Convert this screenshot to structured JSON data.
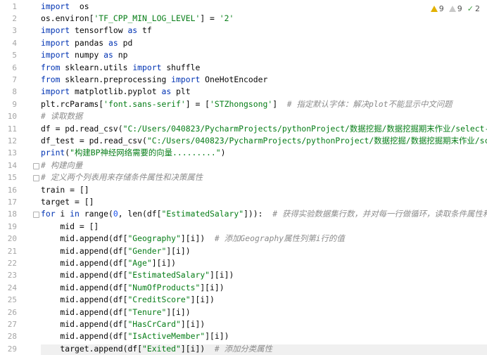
{
  "inspections": {
    "warnings": "9",
    "weak_warnings": "9",
    "typos": "2"
  },
  "lines": [
    {
      "n": "1",
      "tokens": [
        [
          "kw",
          "import"
        ],
        [
          "",
          "  os"
        ]
      ]
    },
    {
      "n": "2",
      "tokens": [
        [
          "",
          "os.environ["
        ],
        [
          "str",
          "'TF_CPP_MIN_LOG_LEVEL'"
        ],
        [
          "",
          "] = "
        ],
        [
          "str",
          "'2'"
        ]
      ]
    },
    {
      "n": "3",
      "tokens": [
        [
          "kw",
          "import"
        ],
        [
          "",
          " tensorflow "
        ],
        [
          "kw",
          "as"
        ],
        [
          "",
          " tf"
        ]
      ]
    },
    {
      "n": "4",
      "tokens": [
        [
          "kw",
          "import"
        ],
        [
          "",
          " pandas "
        ],
        [
          "kw",
          "as"
        ],
        [
          "",
          " pd"
        ]
      ]
    },
    {
      "n": "5",
      "tokens": [
        [
          "kw",
          "import"
        ],
        [
          "",
          " numpy "
        ],
        [
          "kw",
          "as"
        ],
        [
          "",
          " np"
        ]
      ]
    },
    {
      "n": "6",
      "tokens": [
        [
          "kw",
          "from"
        ],
        [
          "",
          " sklearn.utils "
        ],
        [
          "kw",
          "import"
        ],
        [
          "",
          " shuffle"
        ]
      ]
    },
    {
      "n": "7",
      "tokens": [
        [
          "kw",
          "from"
        ],
        [
          "",
          " sklearn.preprocessing "
        ],
        [
          "kw",
          "import"
        ],
        [
          "",
          " OneHotEncoder"
        ]
      ]
    },
    {
      "n": "8",
      "tokens": [
        [
          "kw",
          "import"
        ],
        [
          "",
          " matplotlib.pyplot "
        ],
        [
          "kw",
          "as"
        ],
        [
          "",
          " plt"
        ]
      ]
    },
    {
      "n": "9",
      "tokens": [
        [
          "",
          "plt.rcParams["
        ],
        [
          "str",
          "'font.sans-serif'"
        ],
        [
          "",
          "] = ["
        ],
        [
          "str",
          "'STZhongsong'"
        ],
        [
          "",
          "]  "
        ],
        [
          "cmt",
          "# 指定默认字体：解决plot不能显示中文问题"
        ]
      ]
    },
    {
      "n": "10",
      "tokens": [
        [
          "cmt",
          "# 读取数据"
        ]
      ]
    },
    {
      "n": "11",
      "tokens": [
        [
          "",
          "df = pd.read_csv("
        ],
        [
          "str",
          "\"C:/Users/040823/PycharmProjects/pythonProject/数据挖掘/数据挖掘期末作业/select-data.csv"
        ]
      ]
    },
    {
      "n": "12",
      "tokens": [
        [
          "",
          "df_test = pd.read_csv("
        ],
        [
          "str",
          "\"C:/Users/040823/PycharmProjects/pythonProject/数据挖掘/数据挖掘期末作业/scalar-tes"
        ]
      ]
    },
    {
      "n": "13",
      "tokens": [
        [
          "kw",
          "print"
        ],
        [
          "",
          "("
        ],
        [
          "str",
          "\"构建BP神经网络需要的向量.........\""
        ],
        [
          "",
          ")"
        ]
      ]
    },
    {
      "n": "14",
      "tokens": [
        [
          "cmt",
          "# 构建向量"
        ]
      ]
    },
    {
      "n": "15",
      "tokens": [
        [
          "cmt",
          "# 定义两个列表用来存储条件属性和决策属性"
        ]
      ]
    },
    {
      "n": "16",
      "tokens": [
        [
          "",
          "train = []"
        ]
      ]
    },
    {
      "n": "17",
      "tokens": [
        [
          "",
          "target = []"
        ]
      ]
    },
    {
      "n": "18",
      "tokens": [
        [
          "kw",
          "for"
        ],
        [
          "",
          " i "
        ],
        [
          "kw",
          "in"
        ],
        [
          "",
          " range("
        ],
        [
          "num",
          "0"
        ],
        [
          "",
          ", len(df["
        ],
        [
          "str",
          "\"EstimatedSalary\""
        ],
        [
          "",
          "])):  "
        ],
        [
          "cmt",
          "# 获得实验数据集行数，并对每一行做循环，读取条件属性和决策属性"
        ]
      ]
    },
    {
      "n": "19",
      "tokens": [
        [
          "",
          "    mid = []"
        ]
      ]
    },
    {
      "n": "20",
      "tokens": [
        [
          "",
          "    mid.append(df["
        ],
        [
          "str",
          "\"Geography\""
        ],
        [
          "",
          "][i])  "
        ],
        [
          "cmt",
          "# 添加Geography属性列第i行的值"
        ]
      ]
    },
    {
      "n": "21",
      "tokens": [
        [
          "",
          "    mid.append(df["
        ],
        [
          "str",
          "\"Gender\""
        ],
        [
          "",
          "][i])"
        ]
      ]
    },
    {
      "n": "22",
      "tokens": [
        [
          "",
          "    mid.append(df["
        ],
        [
          "str",
          "\"Age\""
        ],
        [
          "",
          "][i])"
        ]
      ]
    },
    {
      "n": "23",
      "tokens": [
        [
          "",
          "    mid.append(df["
        ],
        [
          "str",
          "\"EstimatedSalary\""
        ],
        [
          "",
          "][i])"
        ]
      ]
    },
    {
      "n": "24",
      "tokens": [
        [
          "",
          "    mid.append(df["
        ],
        [
          "str",
          "\"NumOfProducts\""
        ],
        [
          "",
          "][i])"
        ]
      ]
    },
    {
      "n": "25",
      "tokens": [
        [
          "",
          "    mid.append(df["
        ],
        [
          "str",
          "\"CreditScore\""
        ],
        [
          "",
          "][i])"
        ]
      ]
    },
    {
      "n": "26",
      "tokens": [
        [
          "",
          "    mid.append(df["
        ],
        [
          "str",
          "\"Tenure\""
        ],
        [
          "",
          "][i])"
        ]
      ]
    },
    {
      "n": "27",
      "tokens": [
        [
          "",
          "    mid.append(df["
        ],
        [
          "str",
          "\"HasCrCard\""
        ],
        [
          "",
          "][i])"
        ]
      ]
    },
    {
      "n": "28",
      "tokens": [
        [
          "",
          "    mid.append(df["
        ],
        [
          "str",
          "\"IsActiveMember\""
        ],
        [
          "",
          "][i])"
        ]
      ]
    },
    {
      "n": "29",
      "tokens": [
        [
          "",
          "    target.append(df["
        ],
        [
          "str",
          "\"Exited\""
        ],
        [
          "",
          "][i])  "
        ],
        [
          "cmt",
          "# 添加分类属性"
        ]
      ]
    }
  ]
}
